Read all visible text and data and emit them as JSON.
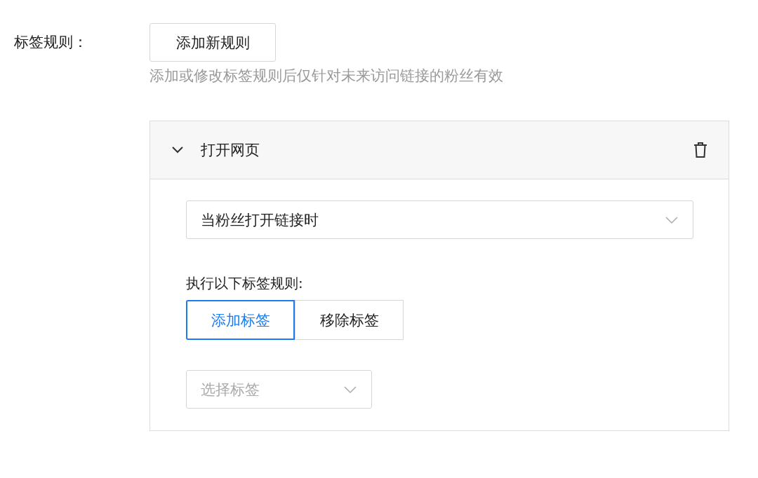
{
  "rule_label": "标签规则：",
  "add_button": "添加新规则",
  "hint": "添加或修改标签规则后仅针对未来访问链接的粉丝有效",
  "rules": [
    {
      "title": "打开网页",
      "expanded": true,
      "trigger": {
        "value": "当粉丝打开链接时"
      },
      "action_label": "执行以下标签规则:",
      "actions": [
        {
          "label": "添加标签",
          "selected": true
        },
        {
          "label": "移除标签",
          "selected": false
        }
      ],
      "tag_select": {
        "placeholder": "选择标签"
      }
    }
  ]
}
